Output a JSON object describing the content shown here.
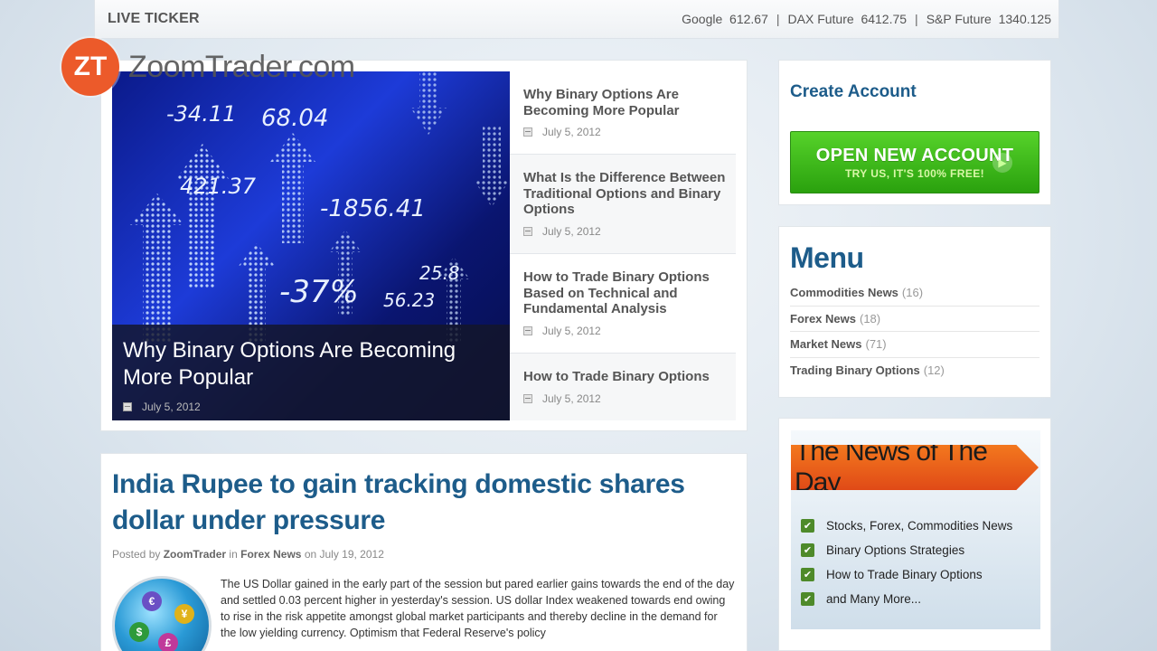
{
  "ticker": {
    "title": "LIVE TICKER",
    "quotes": [
      {
        "name": "Google",
        "value": "612.67"
      },
      {
        "name": "DAX Future",
        "value": "6412.75"
      },
      {
        "name": "S&P Future",
        "value": "1340.125"
      }
    ]
  },
  "logo": {
    "badge": "ZT",
    "text": "ZoomTrader.com",
    "color": "#ec5a2a"
  },
  "featured": {
    "hero": {
      "title": "Why Binary Options Are Becoming More Popular",
      "date": "July 5, 2012",
      "image_numbers": [
        "-34.11",
        "68.04",
        "421.37",
        "-1856.41",
        "-37%",
        "56.23",
        "25.8"
      ]
    },
    "posts": [
      {
        "title": "Why Binary Options Are Becoming More Popular",
        "date": "July 5, 2012"
      },
      {
        "title": "What Is the Difference Between Traditional Options and Binary Options",
        "date": "July 5, 2012"
      },
      {
        "title": "How to Trade Binary Options Based on Technical and Fundamental Analysis",
        "date": "July 5, 2012"
      },
      {
        "title": "How to Trade Binary Options",
        "date": "July 5, 2012"
      }
    ]
  },
  "article": {
    "title": "India Rupee to gain tracking domestic shares dollar under pressure",
    "meta": {
      "posted_by": "Posted by",
      "author": "ZoomTrader",
      "in": "in",
      "category": "Forex News",
      "on": "on July 19, 2012"
    },
    "globe_symbols": [
      "€",
      "¥",
      "$",
      "£"
    ],
    "body": "The US Dollar gained in the early part of the session but pared earlier gains towards the end of the day and settled 0.03 percent higher in yesterday's session. US dollar Index weakened towards end owing to rise in the risk appetite amongst global market participants and thereby decline in the demand for the low yielding currency. Optimism that Federal Reserve's policy"
  },
  "create_account": {
    "title": "Create Account",
    "button_line1": "OPEN NEW ACCOUNT",
    "button_line2": "TRY US, IT'S 100% FREE!",
    "button_color": "#3cb81a"
  },
  "menu": {
    "title": "Menu",
    "items": [
      {
        "label": "Commodities News",
        "count": "(16)"
      },
      {
        "label": "Forex News",
        "count": "(18)"
      },
      {
        "label": "Market News",
        "count": "(71)"
      },
      {
        "label": "Trading Binary Options",
        "count": "(12)"
      }
    ]
  },
  "news_of_day": {
    "banner": "The News of The Day",
    "items": [
      "Stocks, Forex, Commodities News",
      "Binary Options Strategies",
      "How to Trade Binary Options",
      "and Many More..."
    ]
  },
  "colors": {
    "heading_blue": "#1d5c8a",
    "link_green": "#4e8a2a"
  }
}
